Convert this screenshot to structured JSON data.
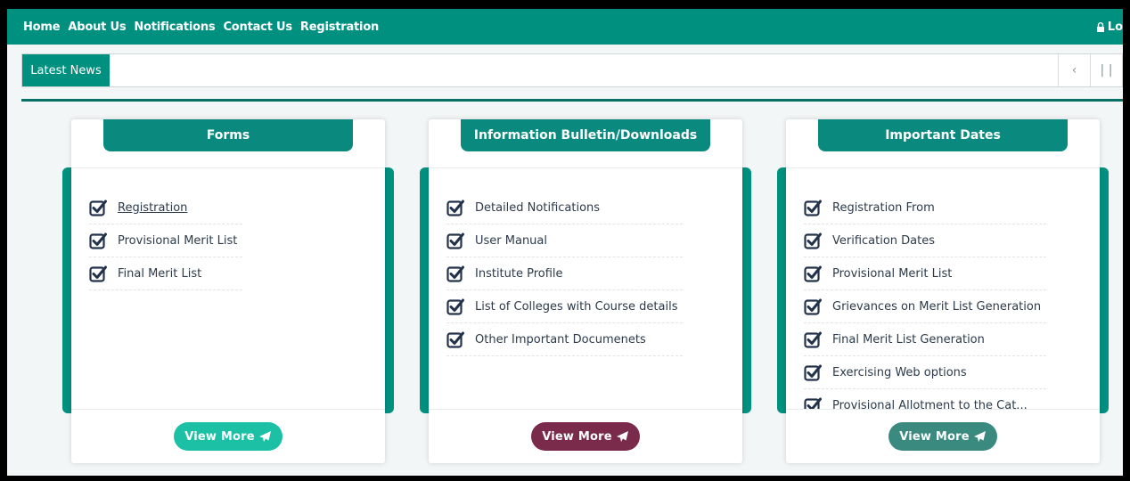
{
  "nav": {
    "links": [
      "Home",
      "About Us",
      "Notifications",
      "Contact Us",
      "Registration"
    ],
    "login": "Lo"
  },
  "news": {
    "label": "Latest News",
    "prev": "‹",
    "pause": "| |"
  },
  "panels": [
    {
      "title": "Forms",
      "items": [
        "Registration",
        "Provisional Merit List",
        "Final Merit List"
      ],
      "button": "View More",
      "button_color": "#1cc0a4"
    },
    {
      "title": "Information Bulletin/Downloads",
      "items": [
        "Detailed Notifications",
        "User Manual",
        "Institute Profile",
        "List of Colleges with Course details",
        "Other Important Documenets"
      ],
      "button": "View More",
      "button_color": "#7a2a4a"
    },
    {
      "title": "Important Dates",
      "items": [
        "Registration From",
        "Verification Dates",
        "Provisional Merit List",
        "Grievances on Merit List Generation",
        "Final Merit List Generation",
        "Exercising Web options",
        "Provisional Allotment to the Cat..."
      ],
      "button": "View More",
      "button_color": "#3a8a80"
    }
  ],
  "colors": {
    "primary": "#00907f",
    "check": "#22324a"
  }
}
